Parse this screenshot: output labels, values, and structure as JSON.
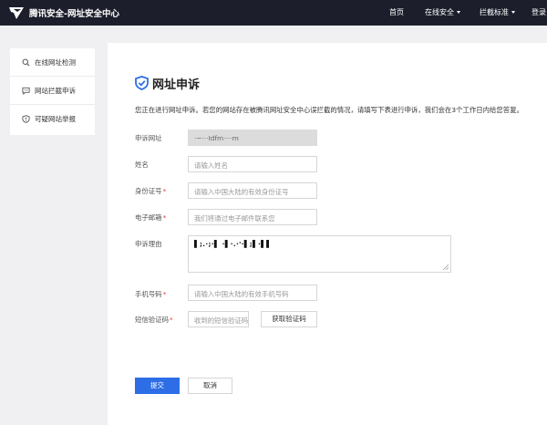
{
  "header": {
    "brand": "腾讯安全-网址安全中心",
    "nav": [
      {
        "label": "首页",
        "dropdown": false
      },
      {
        "label": "在线安全",
        "dropdown": true
      },
      {
        "label": "拦截标准",
        "dropdown": true
      },
      {
        "label": "登录",
        "dropdown": false
      }
    ]
  },
  "sidebar": {
    "items": [
      {
        "label": "在线网址检测",
        "icon": "search-icon"
      },
      {
        "label": "网站拦截申诉",
        "icon": "chat-icon"
      },
      {
        "label": "可疑网站举报",
        "icon": "shield-icon"
      }
    ]
  },
  "main": {
    "title": "网址申诉",
    "intro": "您正在进行网址申诉。若您的网站存在被腾讯网址安全中心误拦截的情况，请填写下表进行申诉，我们会在3个工作日内给您答复。",
    "form": {
      "url": {
        "label": "申诉网址",
        "required": false,
        "value": "·~···Idfm····m"
      },
      "name": {
        "label": "姓名",
        "required": false,
        "placeholder": "请输入姓名"
      },
      "id_number": {
        "label": "身份证号",
        "required": true,
        "placeholder": "请输入中国大陆的有效身份证号"
      },
      "email": {
        "label": "电子邮箱",
        "required": true,
        "placeholder": "我们将通过电子邮件联系您"
      },
      "reason": {
        "label": "申诉理由",
        "required": false,
        "value": "▌;.·;·▌ ·▌·.·'·▌;▌·▌▌"
      },
      "phone": {
        "label": "手机号码",
        "required": true,
        "placeholder": "请输入中国大陆的有效手机号码"
      },
      "sms": {
        "label": "短信验证码",
        "required": true,
        "placeholder": "收到的短信验证码",
        "button": "获取验证码"
      }
    },
    "submit_label": "提交",
    "cancel_label": "取消"
  },
  "colors": {
    "header_bg": "#1c1f2b",
    "accent": "#2d6ee6",
    "required": "#e4393c"
  }
}
